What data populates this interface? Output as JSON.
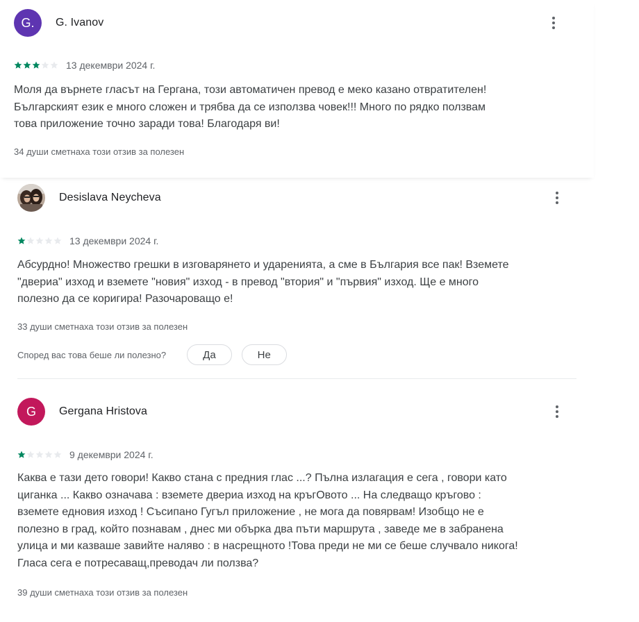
{
  "colors": {
    "star_filled": "#01875f",
    "star_empty": "#e8eaed",
    "avatar_g_ivanov": "#5e35b1",
    "avatar_gergana": "#c2185b"
  },
  "reviews": [
    {
      "avatar_letter": "G.",
      "name": "G. Ivanov",
      "rating": 3,
      "date": "13 декември 2024 г.",
      "text": "Моля да върнете гласът на Гергана, този автоматичен превод е меко казано отвратителен!\nБългарският език е много сложен и трябва да се използва човек!!! Много по рядко ползвам\nтова приложение точно заради това! Благодаря ви!",
      "helpful": "34 души сметнаха този отзив за полезен"
    },
    {
      "avatar_letter": "",
      "name": "Desislava Neycheva",
      "rating": 1,
      "date": "13 декември 2024 г.",
      "text": "Абсурдно! Множество грешки в изговарянето и ударенията, а сме в България все пак! Вземете\n\"двериа\" изход и вземете \"новия\" изход - в превод \"втория\" и \"първия\" изход. Ще е много\nполезно да се коригира! Разочароващо е!",
      "helpful": "33 души сметнаха този отзив за полезен",
      "question": "Според вас това беше ли полезно?",
      "yes_label": "Да",
      "no_label": "Не"
    },
    {
      "avatar_letter": "G",
      "name": "Gergana Hristova",
      "rating": 1,
      "date": "9 декември 2024 г.",
      "text": "Каква е тази дето говори! Какво стана с предния глас ...? Пълна излагация е сега , говори като\nциганка ... Какво означава : вземете двериа изход на кръгОвото ... На следващо кръгово :\nвземете едновия изход ! Съсипано Гугъл приложение , не мога да повярвам! Изобщо не е\nполезно в град, който познавам , днес ми обърка два пъти маршрута , заведе ме в забранена\nулица и ми казваше завийте наляво : в насрещното !Това преди не ми се беше случвало никога!\nГласа сега е потресаващ,преводач ли ползва?",
      "helpful": "39 души сметнаха този отзив за полезен"
    }
  ]
}
